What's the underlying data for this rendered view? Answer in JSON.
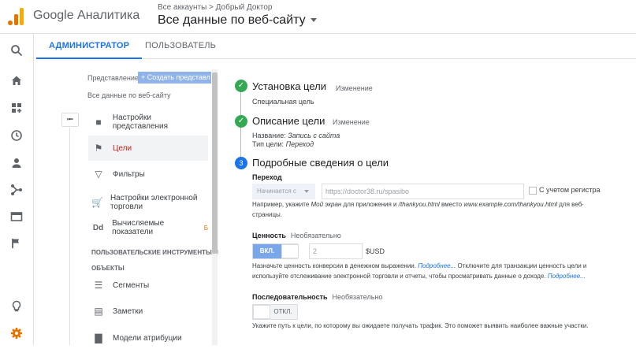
{
  "header": {
    "product": "Google Аналитика",
    "breadcrumb": "Все аккаунты > Добрый Доктор",
    "view_name": "Все данные по веб-сайту"
  },
  "rail": {
    "icons": [
      "search-icon",
      "home-icon",
      "customization-icon",
      "clock-icon",
      "person-icon",
      "acquisition-icon",
      "behavior-icon",
      "flag-icon",
      "lightbulb-icon",
      "gear-icon"
    ]
  },
  "tabs": {
    "admin": "АДМИНИСТРАТОР",
    "user": "ПОЛЬЗОВАТЕЛЬ"
  },
  "nav": {
    "view_label": "Представление",
    "create_button": "Создать представл",
    "view_select": "Все данные по веб-сайту",
    "items": [
      {
        "label": "Настройки представления",
        "icon": "document-icon"
      },
      {
        "label": "Цели",
        "icon": "flag-icon"
      },
      {
        "label": "Фильтры",
        "icon": "filter-icon"
      },
      {
        "label": "Настройки электронной торговли",
        "icon": "cart-icon"
      },
      {
        "label": "Вычисляемые показатели",
        "icon": "calculated-metric-icon",
        "badge": "Б"
      }
    ],
    "section_tools": "ПОЛЬЗОВАТЕЛЬСКИЕ ИНСТРУМЕНТЫ И",
    "section_objects": "ОБЪЕКТЫ",
    "tool_items": [
      {
        "label": "Сегменты",
        "icon": "segments-icon"
      },
      {
        "label": "Заметки",
        "icon": "notes-icon"
      },
      {
        "label": "Модели атрибуции",
        "icon": "attribution-icon"
      }
    ]
  },
  "goal": {
    "step1": {
      "title": "Установка цели",
      "edit": "Изменение",
      "value": "Специальная цель"
    },
    "step2": {
      "title": "Описание цели",
      "edit": "Изменение",
      "name_label": "Название:",
      "name_value": "Запись с сайта",
      "type_label": "Тип цели:",
      "type_value": "Переход"
    },
    "step3": {
      "number": "3",
      "title": "Подробные сведения о цели",
      "destination_label": "Переход",
      "match_select": "Начинается с",
      "url_placeholder": "https://doctor38.ru/spasibo",
      "case_label": "С учетом регистра",
      "destination_help_1": "Например, укажите ",
      "destination_help_2": "Мой экран",
      "destination_help_3": " для приложения и ",
      "destination_help_4": "/thankyou.html",
      "destination_help_5": " вместо ",
      "destination_help_6": "www.example.com/thankyou.html",
      "destination_help_7": " для веб-",
      "destination_help_8": "страницы.",
      "value_label": "Ценность",
      "optional": "Необязательно",
      "value_toggle": "ВКЛ.",
      "value_input": "2",
      "currency": "$USD",
      "value_help_1": "Назначьте ценность конверсии в денежном выражении. ",
      "value_help_more": "Подробнее...",
      "value_help_2": " Отключите для транзакции ценность цели и",
      "value_help_3": "используйте отслеживание электронной торговли и отчеты, чтобы просматривать данные о доходе. ",
      "funnel_label": "Последовательность",
      "funnel_toggle": "ОТКЛ.",
      "funnel_help": "Укажите путь к цели, по которому вы ожидаете получать трафик. Это поможет выявить наиболее важные участки."
    }
  }
}
